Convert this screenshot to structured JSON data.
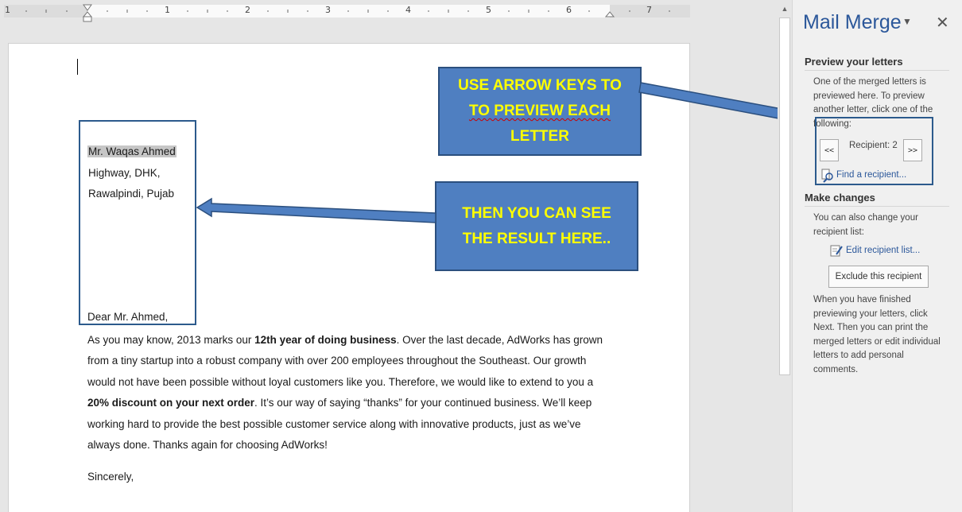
{
  "ruler": {
    "numbers": [
      "1",
      "1",
      "2",
      "3",
      "4",
      "5",
      "6",
      "7"
    ]
  },
  "document": {
    "address": [
      "Mr. Waqas Ahmed",
      "Highway, DHK,",
      "Rawalpindi, Pujab"
    ],
    "salutation": "Dear Mr. Ahmed,",
    "body": {
      "p1": "As you may know, 2013 marks our ",
      "b1": "12th year of doing business",
      "p2": ". Over the last decade, AdWorks has grown from a tiny startup into a robust company with over 200 employees throughout the Southeast. Our growth would not have been possible without loyal customers like you. Therefore, we would like to extend to you a ",
      "b2": "20% discount on your next order",
      "p3": ". It’s our way of saying “thanks” for your continued business. We’ll keep working hard to provide the best possible customer service along with innovative products, just as we’ve always done. Thanks again for choosing AdWorks!"
    },
    "closing": "Sincerely,"
  },
  "callouts": {
    "preview": {
      "line1": "USE ARROW KEYS TO",
      "line2": "TO  PREVIEW EACH",
      "line3": "LETTER"
    },
    "result": {
      "line1": "THEN YOU CAN SEE",
      "line2": "THE RESULT HERE.."
    }
  },
  "pane": {
    "title": "Mail Merge",
    "preview_heading": "Preview your letters",
    "preview_text": "One of the merged letters is previewed here. To preview another letter, click one of the following:",
    "prev_label": "<<",
    "next_label": ">>",
    "recipient_label": "Recipient: 2",
    "find_recipient": "Find a recipient...",
    "changes_heading": "Make changes",
    "changes_text": "You can also change your recipient list:",
    "edit_list": "Edit recipient list...",
    "exclude_button": "Exclude this recipient",
    "finish_text": "When you have finished previewing your letters, click Next. Then you can print the merged letters or edit individual letters to add personal comments."
  },
  "colors": {
    "accent": "#2b579a",
    "callout_bg": "#4f7fc1",
    "callout_text": "#ffff00",
    "box_border": "#2c5a8c"
  }
}
